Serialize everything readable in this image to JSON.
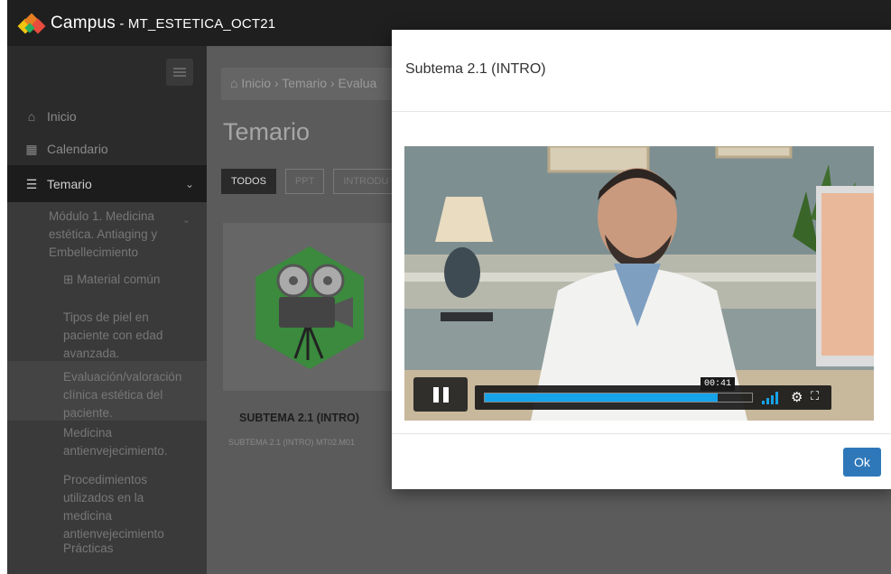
{
  "app": {
    "name": "Campus",
    "separator": " - ",
    "course": "MT_ESTETICA_OCT21"
  },
  "sidebar": {
    "items": [
      {
        "label": "Inicio",
        "icon": "home-icon"
      },
      {
        "label": "Calendario",
        "icon": "calendar-icon"
      },
      {
        "label": "Temario",
        "icon": "list-icon"
      }
    ],
    "module": "Módulo 1. Medicina estética. Antiaging y Embellecimiento",
    "subitems": [
      "Material común",
      "Tipos de piel en paciente con edad avanzada.",
      "Evaluación/valoración clínica estética del paciente.",
      "Medicina antienvejecimiento.",
      "Procedimientos utilizados en la medicina antienvejecimiento",
      "Prácticas"
    ]
  },
  "main": {
    "breadcrumb": [
      "Inicio",
      "Temario",
      "Evalua"
    ],
    "title": "Temario",
    "filters": [
      "TODOS",
      "PPT",
      "INTRODU"
    ],
    "card": {
      "title": "SUBTEMA 2.1 (INTRO)",
      "subtitle": "SUBTEMA 2.1 (INTRO) MT02.M01"
    }
  },
  "modal": {
    "title": "Subtema 2.1 (INTRO)",
    "ok_label": "Ok",
    "video": {
      "current_time": "00:41",
      "progress": 0.87,
      "playing": true
    }
  },
  "colors": {
    "accent": "#17a3e8",
    "ok_button": "#2e78b9",
    "topbar": "#1f1f1f",
    "sidebar": "#2b2b2b"
  }
}
